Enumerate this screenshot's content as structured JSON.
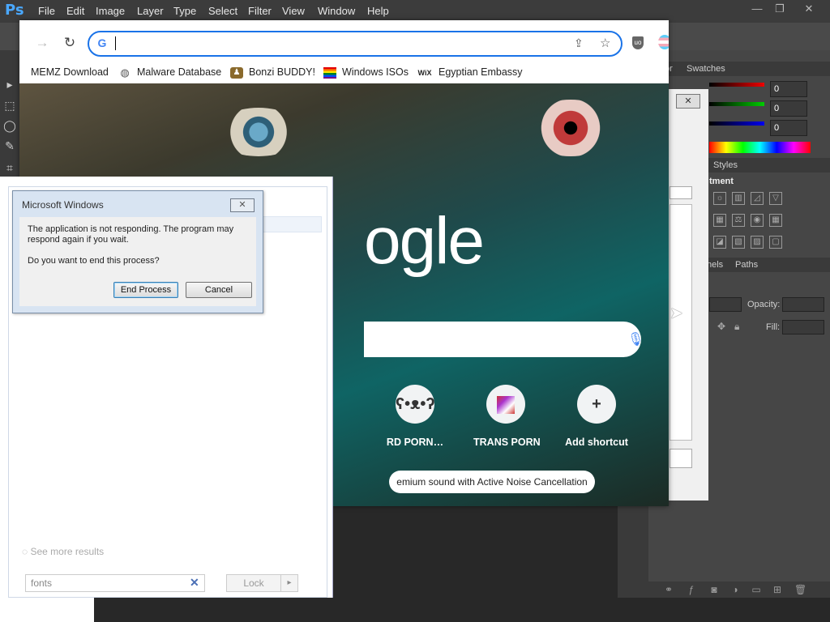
{
  "photoshop": {
    "logo": "Ps",
    "menu": [
      "File",
      "Edit",
      "Image",
      "Layer",
      "Type",
      "Select",
      "Filter",
      "View",
      "Window",
      "Help"
    ],
    "window_controls": [
      "—",
      "❐",
      "✕"
    ],
    "panel_tabs": {
      "color_partial": "or",
      "swatches": "Swatches",
      "styles": "Styles",
      "adjustments_partial": "tment",
      "channels_partial": "nels",
      "paths": "Paths"
    },
    "rgb_values": [
      "0",
      "0",
      "0"
    ],
    "opacity_label": "Opacity:",
    "fill_label": "Fill:",
    "colors": {
      "bg": "#282828",
      "menubar": "#3c3c3c",
      "panel": "#464646"
    }
  },
  "browser": {
    "bookmarks": [
      {
        "label": "MEMZ Download",
        "icon": "document-icon"
      },
      {
        "label": "Malware Database",
        "icon": "globe-icon"
      },
      {
        "label": "Bonzi BUDDY!",
        "icon": "bonzi-icon"
      },
      {
        "label": "Windows ISOs",
        "icon": "windows-icon"
      },
      {
        "label": "Egyptian Embassy",
        "icon": "wix-icon"
      }
    ],
    "wix_glyph": "WiX",
    "logo_text": "ogle",
    "shortcuts": [
      {
        "label": "RD PORN…",
        "icon": "bear-icon"
      },
      {
        "label": "TRANS PORN",
        "icon": "image-icon"
      },
      {
        "label": "Add shortcut",
        "icon": "plus-icon",
        "glyph": "+"
      }
    ],
    "promo": "emium sound with Active Noise Cancellation"
  },
  "search_pane": {
    "see_more": "See more results",
    "query": "fonts",
    "lock_label": "Lock"
  },
  "dialog": {
    "title": "Microsoft Windows",
    "message": "The application is not responding. The program may respond again if you wait.",
    "question": "Do you want to end this process?",
    "end_button": "End Process",
    "cancel_button": "Cancel"
  }
}
